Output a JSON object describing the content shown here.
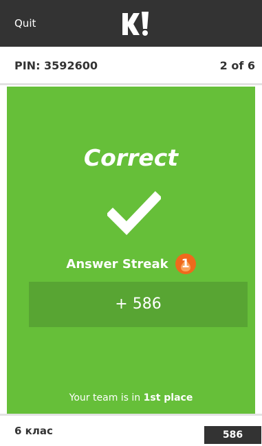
{
  "header": {
    "quit_label": "Quit",
    "logo_text": "K!",
    "background_color": "#333333"
  },
  "game": {
    "pin": "PIN: 3592600",
    "progress": "2 of 6"
  },
  "result": {
    "status": "Correct",
    "icon": "checkmark-icon",
    "panel_color": "#66bf39",
    "streak_label": "Answer Streak",
    "streak_count": "1",
    "points": "+ 586",
    "rank_prefix": "Your team is in ",
    "rank_place": "1st place"
  },
  "footer": {
    "team_name": "6 клас",
    "score": "586"
  }
}
